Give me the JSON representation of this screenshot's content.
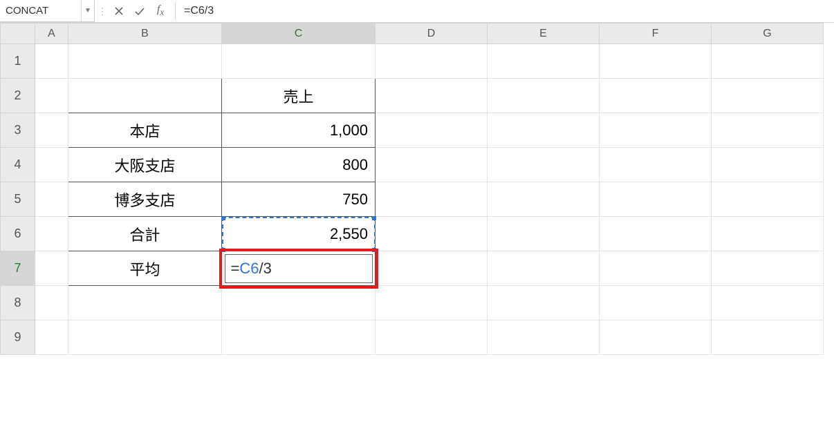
{
  "namebox": "CONCAT",
  "formula_bar": "=C6/3",
  "columns": [
    "A",
    "B",
    "C",
    "D",
    "E",
    "F",
    "G"
  ],
  "rows": [
    "1",
    "2",
    "3",
    "4",
    "5",
    "6",
    "7",
    "8",
    "9"
  ],
  "active_col": "C",
  "active_row": "7",
  "table": {
    "header_sales": "売上",
    "r3_label": "本店",
    "r3_val": "1,000",
    "r4_label": "大阪支店",
    "r4_val": "800",
    "r5_label": "博多支店",
    "r5_val": "750",
    "r6_label": "合計",
    "r6_val": "2,550",
    "r7_label": "平均"
  },
  "editing": {
    "eq": "=",
    "ref": "C6",
    "rest": "/3"
  },
  "chart_data": {
    "type": "table",
    "title": "売上",
    "rows": [
      {
        "label": "本店",
        "value": 1000
      },
      {
        "label": "大阪支店",
        "value": 800
      },
      {
        "label": "博多支店",
        "value": 750
      },
      {
        "label": "合計",
        "value": 2550
      }
    ],
    "editing_formula": "=C6/3"
  }
}
